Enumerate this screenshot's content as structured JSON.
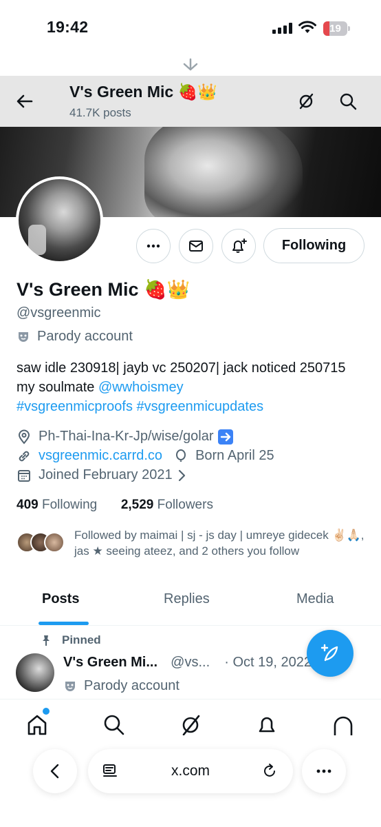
{
  "status_bar": {
    "time": "19:42",
    "battery": "19"
  },
  "header": {
    "title": "V's Green Mic 🍓👑",
    "posts_count": "41.7K posts"
  },
  "profile": {
    "name": "V's Green Mic 🍓👑",
    "handle": "@vsgreenmic",
    "parody_label": "Parody account",
    "bio_text": "saw idle 230918| jayb vc 250207| jack noticed 250715 my soulmate ",
    "bio_mention": "@wwhoismey",
    "bio_hashtags": "#vsgreenmicproofs #vsgreenmicupdates",
    "location": "Ph-Thai-Ina-Kr-Jp/wise/golar",
    "website": "vsgreenmic.carrd.co",
    "birthday": "Born April 25",
    "joined": "Joined February 2021",
    "following_count": "409",
    "following_label": "Following",
    "followers_count": "2,529",
    "followers_label": "Followers",
    "followed_by": "Followed by maimai | sj - js day | umreye gidecek ✌🏻🙏🏻, jas ★ seeing ateez, and 2 others you follow"
  },
  "actions": {
    "following_button": "Following"
  },
  "tabs": [
    "Posts",
    "Replies",
    "Media"
  ],
  "pinned_post": {
    "pinned_label": "Pinned",
    "author_name": "V's Green Mi...",
    "author_handle": "@vs...",
    "date": "· Oct 19, 2022",
    "parody_label": "Parody account"
  },
  "browser": {
    "url": "x.com"
  },
  "icons": [
    "back-arrow-icon",
    "grok-icon",
    "search-icon",
    "more-icon",
    "mail-icon",
    "bell-plus-icon",
    "mask-icon",
    "location-icon",
    "link-icon",
    "balloon-icon",
    "calendar-icon",
    "pin-icon",
    "compose-icon",
    "home-icon",
    "notifications-icon",
    "messages-icon",
    "reader-icon",
    "reload-icon"
  ],
  "colors": {
    "accent": "#1d9bf0",
    "text_secondary": "#536471",
    "battery_low": "#e5484d"
  }
}
